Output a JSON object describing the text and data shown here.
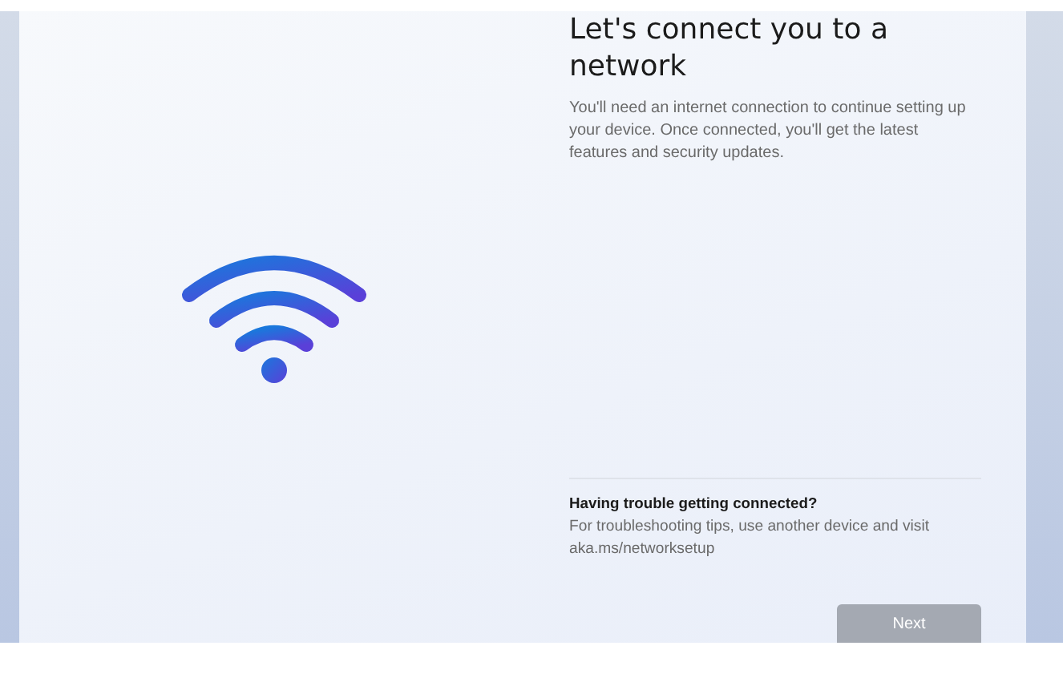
{
  "title": "Let's connect you to a network",
  "description": "You'll need an internet connection to continue setting up your device. Once connected, you'll get the latest features and security updates.",
  "help": {
    "heading": "Having trouble getting connected?",
    "text": "For troubleshooting tips, use another device and visit aka.ms/networksetup"
  },
  "next_button": {
    "label": "Next",
    "disabled": true
  }
}
